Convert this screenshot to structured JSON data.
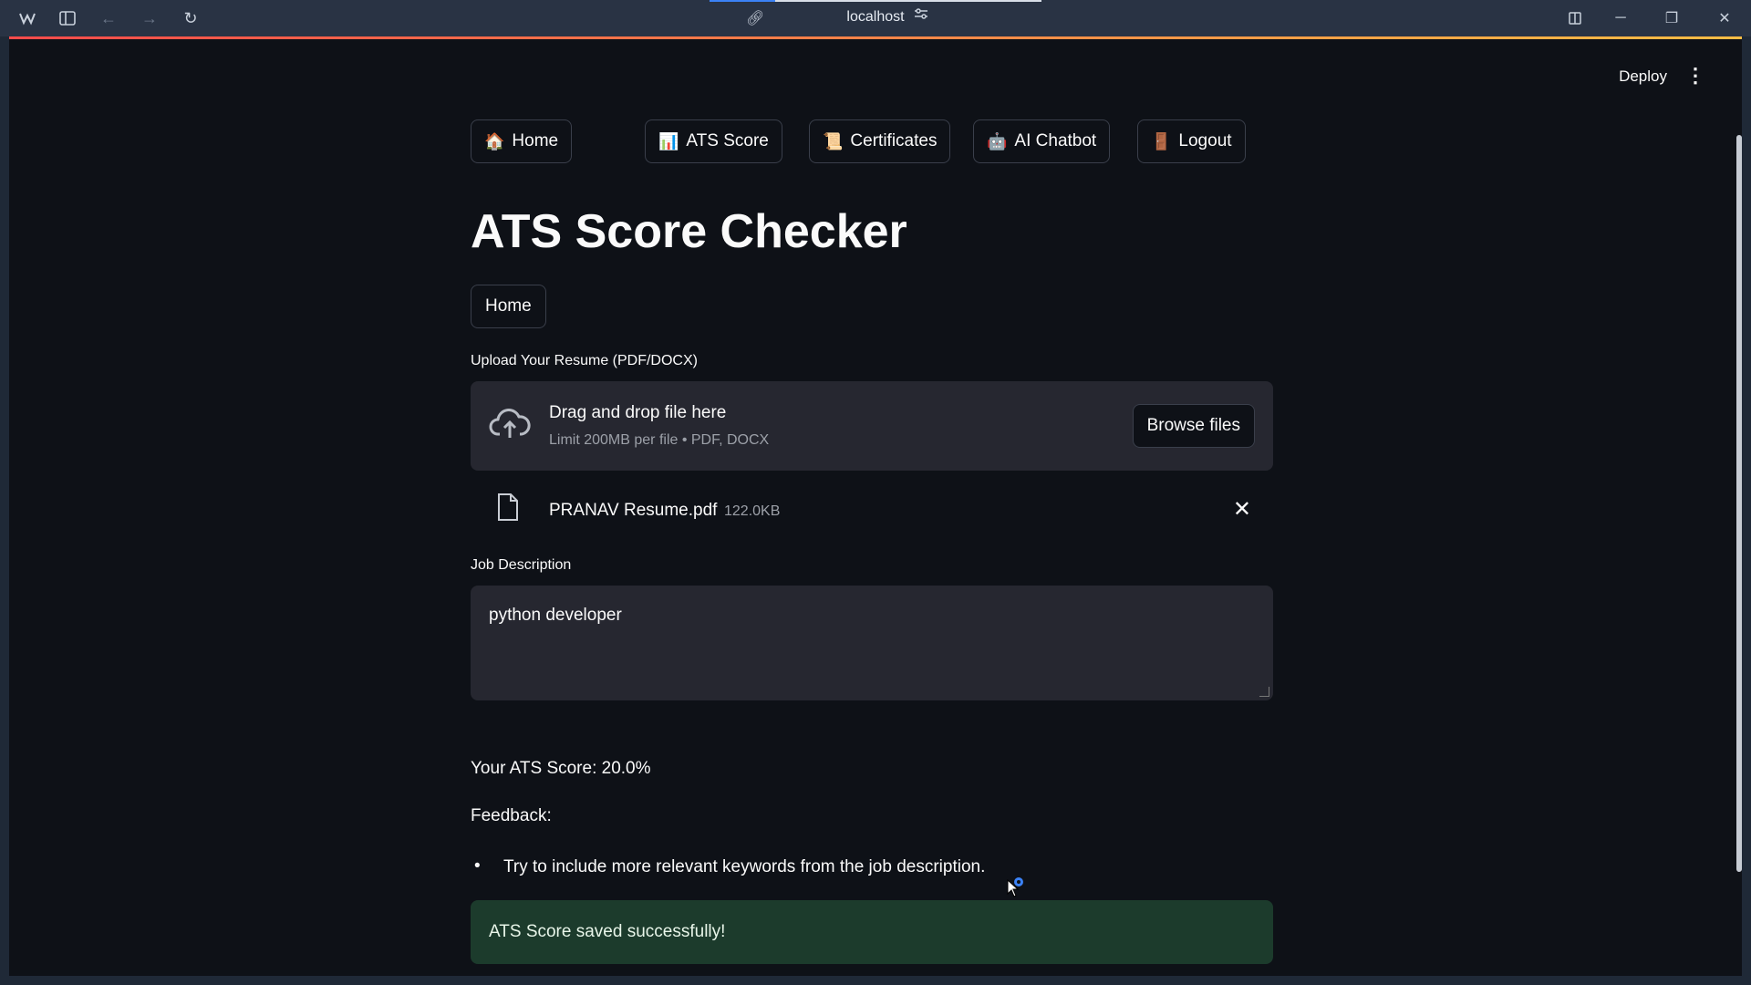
{
  "browser": {
    "url": "localhost"
  },
  "header": {
    "deploy_label": "Deploy"
  },
  "nav": [
    {
      "emoji": "🏠",
      "label": "Home"
    },
    {
      "emoji": "📊",
      "label": "ATS Score"
    },
    {
      "emoji": "📜",
      "label": "Certificates"
    },
    {
      "emoji": "🤖",
      "label": "AI Chatbot"
    },
    {
      "emoji": "🚪",
      "label": "Logout"
    }
  ],
  "page": {
    "title": "ATS Score Checker",
    "home_button": "Home"
  },
  "upload": {
    "label": "Upload Your Resume (PDF/DOCX)",
    "drop_title": "Drag and drop file here",
    "drop_sub": "Limit 200MB per file • PDF, DOCX",
    "browse_label": "Browse files",
    "file_name": "PRANAV Resume.pdf",
    "file_size": "122.0KB"
  },
  "job": {
    "label": "Job Description",
    "value": "python developer"
  },
  "result": {
    "score_text": "Your ATS Score: 20.0%",
    "feedback_label": "Feedback:",
    "feedback_items": [
      "Try to include more relevant keywords from the job description."
    ],
    "success_text": "ATS Score saved successfully!"
  },
  "colors": {
    "background": "#0e1117",
    "input_bg": "#262730",
    "success_bg": "#1c3b2c",
    "accent_gradient_start": "#ff4b4b",
    "accent_gradient_end": "#ffbd45"
  }
}
